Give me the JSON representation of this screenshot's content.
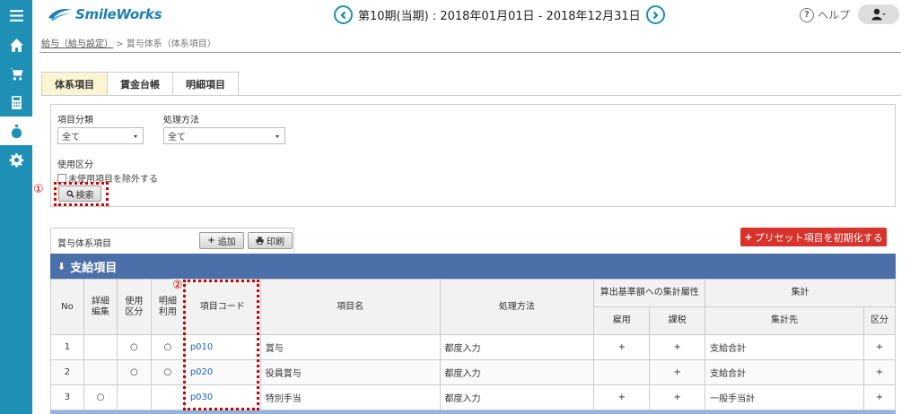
{
  "app": {
    "logo_text": "SmileWorks"
  },
  "header": {
    "period": "第10期(当期) : 2018年01月01日 - 2018年12月31日",
    "help_label": "ヘルプ"
  },
  "sidebar": {
    "items": [
      {
        "icon": "menu-icon"
      },
      {
        "icon": "home-icon"
      },
      {
        "icon": "cart-icon"
      },
      {
        "icon": "calculator-icon"
      },
      {
        "icon": "money-bag-icon",
        "active": true
      },
      {
        "icon": "gear-icon"
      }
    ]
  },
  "breadcrumb": {
    "link": "給与（給与設定）",
    "separator": " > ",
    "current": "賞与体系（体系項目）"
  },
  "tabs": [
    {
      "label": "体系項目",
      "active": true
    },
    {
      "label": "賃金台帳"
    },
    {
      "label": "明細項目"
    }
  ],
  "filter": {
    "category_label": "項目分類",
    "category_value": "全て",
    "method_label": "処理方法",
    "method_value": "全て",
    "usage_label": "使用区分",
    "exclude_unused_label": "未使用項目を除外する",
    "search_label": "検索",
    "annotation_1": "①"
  },
  "actions": {
    "title": "賞与体系項目",
    "add_label": "追加",
    "print_label": "印刷",
    "preset_label": "プリセット項目を初期化する"
  },
  "section": {
    "title": "支給項目"
  },
  "table": {
    "headers": {
      "no": "No",
      "detail_edit": "詳細\n編集",
      "usage": "使用\n区分",
      "detail_usage": "明細\n利用",
      "code": "項目コード",
      "name": "項目名",
      "method": "処理方法",
      "calc_group": "算出基準額への集計屬性",
      "employment": "雇用",
      "tax": "課税",
      "aggregate_group": "集計",
      "aggregate_target": "集計先",
      "division": "区分"
    },
    "annotation_2": "②",
    "rows": [
      {
        "no": "1",
        "detail_edit": "",
        "usage": "○",
        "detail_usage": "○",
        "code": "p010",
        "name": "賞与",
        "method": "都度入力",
        "employment": "+",
        "tax": "+",
        "target": "支給合計",
        "division": "+"
      },
      {
        "no": "2",
        "detail_edit": "",
        "usage": "○",
        "detail_usage": "○",
        "code": "p020",
        "name": "役員賞与",
        "method": "都度入力",
        "employment": "",
        "tax": "+",
        "target": "支給合計",
        "division": "+"
      },
      {
        "no": "3",
        "detail_edit": "○",
        "usage": "",
        "detail_usage": "",
        "code": "p030",
        "name": "特別手当",
        "method": "都度入力",
        "employment": "+",
        "tax": "+",
        "target": "一般手当計",
        "division": "+"
      }
    ]
  },
  "colors": {
    "sidebar": "#1e8fb5",
    "section": "#4b70a9",
    "preset": "#d9322c",
    "annotation": "#d40000",
    "active_tab": "#fbf5d3"
  }
}
